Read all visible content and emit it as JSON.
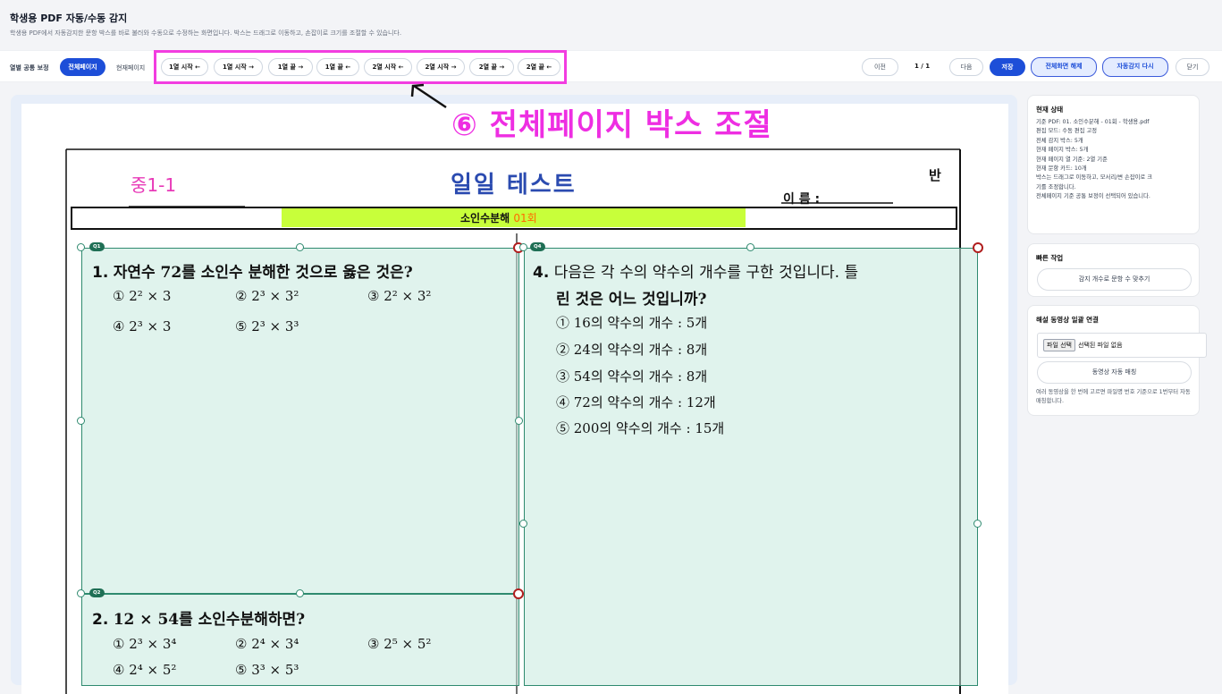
{
  "header": {
    "title": "학생용 PDF 자동/수동 감지",
    "subtitle": "학생용 PDF에서 자동감지한 문항 박스를 바로 불러와 수동으로 수정하는 화면입니다. 박스는 드래그로 이동하고, 손잡이로 크기를 조절할 수 있습니다."
  },
  "toolbar": {
    "column_adjust_label": "열별 공통 보정",
    "scope_all_page": "전체페이지",
    "scope_current_page": "현재페이지",
    "column_buttons": [
      "1열 시작 ←",
      "1열 시작 →",
      "1열 끝 →",
      "1열 끝 ←",
      "2열 시작 ←",
      "2열 시작 →",
      "2열 끝 →",
      "2열 끝 ←"
    ],
    "prev": "이전",
    "page_indicator": "1 / 1",
    "next": "다음",
    "save": "저장",
    "exit_fullscreen": "전체화면 해제",
    "redetect": "자동감지 다시",
    "close": "닫기"
  },
  "annotation": {
    "text": "⑥ 전체페이지 박스 조절",
    "color": "#ee2ee2"
  },
  "exam": {
    "grade": "중1-1",
    "title": "일일 테스트",
    "class_label": "반",
    "name_label": "이 름 :",
    "unit_label": "소인수분해",
    "unit_round": "01회",
    "tags": [
      "Q1",
      "Q4",
      "Q2"
    ],
    "q1_num": "1.",
    "q1_text": "자연수 72를 소인수 분해한 것으로 옳은 것은?",
    "q1_choices": [
      "① 2² × 3",
      "② 2³ × 3²",
      "③ 2² × 3²",
      "④ 2³ × 3",
      "⑤ 2³ × 3³"
    ],
    "q4_num": "4.",
    "q4_text1": "다음은 각 수의 약수의 개수를 구한 것입니다. 틀",
    "q4_text2": "린 것은 어느 것입니까?",
    "q4_choices": [
      "① 16의 약수의 개수 : 5개",
      "② 24의 약수의 개수 : 8개",
      "③ 54의 약수의 개수 : 8개",
      "④ 72의 약수의 개수 : 12개",
      "⑤ 200의 약수의 개수 : 15개"
    ],
    "q2_num": "2.",
    "q2_text": "12 × 54를 소인수분해하면?",
    "q2_choices": [
      "① 2³ × 3⁴",
      "② 2⁴ × 3⁴",
      "③ 2⁵ × 5²",
      "④ 2⁴ × 5²",
      "⑤ 3³ × 5³"
    ]
  },
  "status_card": {
    "title": "현재 상태",
    "lines": [
      "기준 PDF: 01. 소인수분해 - 01회 - 학생용.pdf",
      "편집 모드: 수동 편집 고정",
      "전체 감지 박스: 5개",
      "현재 페이지 박스: 5개",
      "현재 페이지 열 기준: 2열 기준",
      "현재 문항 카드: 10개",
      "박스는 드래그로 이동하고, 모서리/변 손잡이로 크",
      "기를 조정합니다.",
      "전체페이지 기준 공통 보정이 선택되어 있습니다."
    ]
  },
  "quick_card": {
    "title": "빠른 작업",
    "fit_button": "감지 개수로 문항 수 맞추기"
  },
  "video_card": {
    "title": "해설 동영상 일괄 연결",
    "file_button": "파일 선택",
    "file_status": "선택된 파일 없음",
    "match_button": "동영상 자동 매칭",
    "note": "여러 동영상을 한 번에 고르면 파일명 번호 기준으로 1번부터 자동 매칭합니다."
  },
  "colors": {
    "primary": "#1d4ed8",
    "box_fill": "#c6eade",
    "box_border": "#2f8a6f",
    "grade_pink": "#e83ab8",
    "title_blue": "#2b4bb0",
    "unit_bar": "#c8ff3a",
    "round_orange": "#ff6a00"
  }
}
